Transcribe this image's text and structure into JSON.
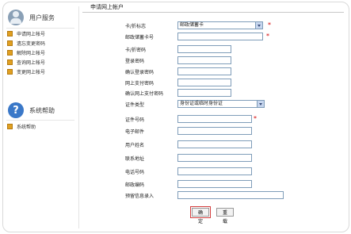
{
  "sidebar": {
    "user_title": "用户服务",
    "user_items": [
      "申请网上帐号",
      "遗忘变更密码",
      "解除网上帐号",
      "查询网上帐号",
      "变更网上帐号"
    ],
    "help_title": "系统帮助",
    "help_items": [
      "系统帮助"
    ]
  },
  "form": {
    "tab_title": "申请网上帐户",
    "labels": {
      "card_flag": "卡/折标志",
      "card_number": "邮政储蓄卡号",
      "card_password": "卡/折密码",
      "login_password": "登录密码",
      "confirm_login_password": "确认登录密码",
      "online_pay_password": "网上支付密码",
      "confirm_online_pay_password": "确认网上支付密码",
      "id_type": "证件类型",
      "id_number": "证件号码",
      "email": "电子邮件",
      "user_name": "用户姓名",
      "address": "联系地址",
      "phone": "电话号码",
      "postcode": "邮政编码",
      "reserved_info": "预留信息录入"
    },
    "card_flag_value": "邮政储蓄卡",
    "id_type_value": "身份证或临时身份证",
    "required_mark": "*"
  },
  "buttons": {
    "confirm": "确定",
    "reset": "重载"
  },
  "colors": {
    "required": "#d40000",
    "input_border": "#7f9db9",
    "bullet": "#e0a021",
    "confirm_outline": "#d23c3c"
  },
  "icons": {
    "user_section": "user-icon",
    "help_section": "help-icon",
    "list_bullet": "square-bullet-icon",
    "dropdown": "chevron-down-icon"
  }
}
